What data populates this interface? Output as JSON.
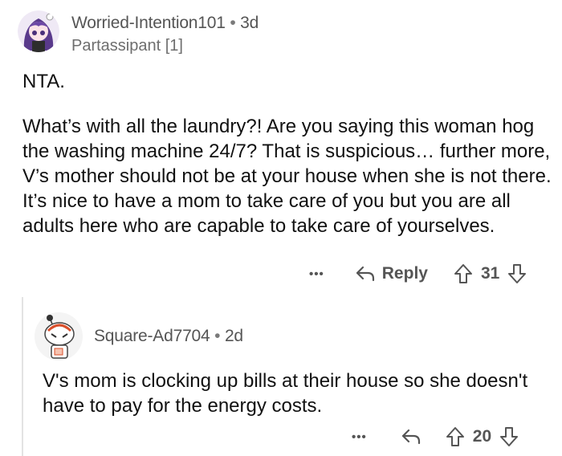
{
  "comments": [
    {
      "username": "Worried-Intention101",
      "separator": "•",
      "age": "3d",
      "flair": "Partassipant [1]",
      "paragraphs": [
        "NTA.",
        "What’s with all the laundry?!  Are you saying this woman hog the washing machine 24/7?  That is suspicious… further more, V’s mother should not be at your house when she is not there.  It’s nice to have a mom to take care of you but you are all adults here who are capable to take care of yourselves."
      ],
      "actions": {
        "more": "•••",
        "reply": "Reply",
        "score": "31"
      }
    },
    {
      "username": "Square-Ad7704",
      "separator": "•",
      "age": "2d",
      "paragraphs": [
        "V's mom is clocking up bills at their house so she doesn't have to pay for the energy costs."
      ],
      "actions": {
        "more": "•••",
        "score": "20"
      }
    }
  ],
  "colors": {
    "text": "#111111",
    "meta": "#555555",
    "thread_line": "#e3e3e3",
    "avatar1_hair": "#5a3a8c"
  },
  "icons": [
    "anime-avatar-icon",
    "snoo-avatar-icon",
    "more-icon",
    "reply-arrow-icon",
    "upvote-icon",
    "downvote-icon"
  ]
}
